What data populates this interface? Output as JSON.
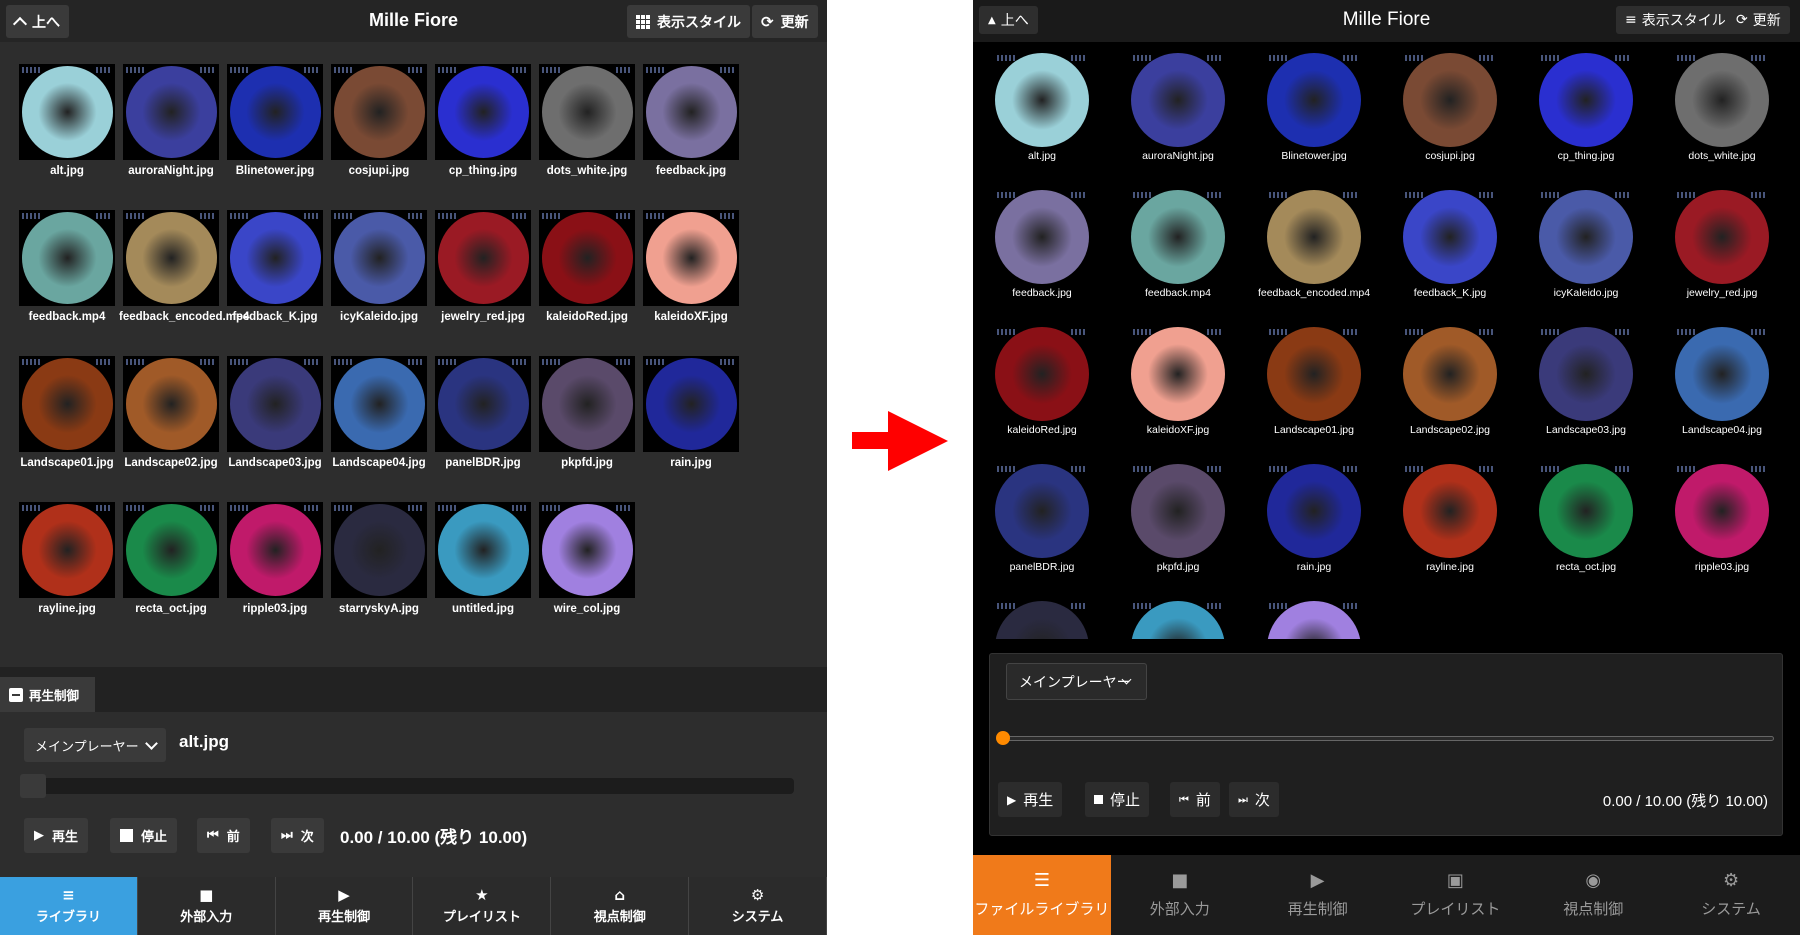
{
  "left": {
    "header": {
      "up_label": "上へ",
      "title": "Mille Fiore",
      "style_label": "表示スタイル",
      "refresh_label": "更新"
    },
    "library": [
      {
        "name": "alt.jpg",
        "color": "#9ad0d8"
      },
      {
        "name": "auroraNight.jpg",
        "color": "#3b3f9e"
      },
      {
        "name": "Blinetower.jpg",
        "color": "#1d2fb0"
      },
      {
        "name": "cosjupi.jpg",
        "color": "#7a4a34"
      },
      {
        "name": "cp_thing.jpg",
        "color": "#2a2fd0"
      },
      {
        "name": "dots_white.jpg",
        "color": "#6e6e6e"
      },
      {
        "name": "feedback.jpg",
        "color": "#7a70a0"
      },
      {
        "name": "feedback.mp4",
        "color": "#6aa6a0"
      },
      {
        "name": "feedback_encoded.mp4",
        "color": "#a48a5a"
      },
      {
        "name": "feedback_K.jpg",
        "color": "#3a46c8"
      },
      {
        "name": "icyKaleido.jpg",
        "color": "#4a5aa8"
      },
      {
        "name": "jewelry_red.jpg",
        "color": "#9a1a24"
      },
      {
        "name": "kaleidoRed.jpg",
        "color": "#8a1016"
      },
      {
        "name": "kaleidoXF.jpg",
        "color": "#f0a090"
      },
      {
        "name": "Landscape01.jpg",
        "color": "#8a3a14"
      },
      {
        "name": "Landscape02.jpg",
        "color": "#a05a28"
      },
      {
        "name": "Landscape03.jpg",
        "color": "#3a3a7a"
      },
      {
        "name": "Landscape04.jpg",
        "color": "#3a6ab0"
      },
      {
        "name": "panelBDR.jpg",
        "color": "#2a3480"
      },
      {
        "name": "pkpfd.jpg",
        "color": "#5a4a6a"
      },
      {
        "name": "rain.jpg",
        "color": "#20289a"
      },
      {
        "name": "rayline.jpg",
        "color": "#b0301a"
      },
      {
        "name": "recta_oct.jpg",
        "color": "#1a8a4a"
      },
      {
        "name": "ripple03.jpg",
        "color": "#c01a6a"
      },
      {
        "name": "starryskyA.jpg",
        "color": "#2a2a40"
      },
      {
        "name": "untitled.jpg",
        "color": "#3a9ac0"
      },
      {
        "name": "wire_col.jpg",
        "color": "#a080e0"
      }
    ],
    "section_label": "再生制御",
    "control": {
      "player_select": "メインプレーヤー",
      "current_file": "alt.jpg",
      "play_label": "再生",
      "stop_label": "停止",
      "prev_label": "前",
      "next_label": "次",
      "time": "0.00 / 10.00 (残り 10.00)"
    },
    "nav": [
      {
        "label": "ライブラリ",
        "icon": "list-icon",
        "glyph": "≡"
      },
      {
        "label": "外部入力",
        "icon": "camera-icon",
        "glyph": "■"
      },
      {
        "label": "再生制御",
        "icon": "play-icon",
        "glyph": "▶"
      },
      {
        "label": "プレイリスト",
        "icon": "star-icon",
        "glyph": "★"
      },
      {
        "label": "視点制御",
        "icon": "home-icon",
        "glyph": "⌂"
      },
      {
        "label": "システム",
        "icon": "gear-icon",
        "glyph": "⚙"
      }
    ]
  },
  "right": {
    "header": {
      "up_label": "上へ",
      "title": "Mille Fiore",
      "style_label": "表示スタイル",
      "refresh_label": "更新"
    },
    "library": [
      {
        "name": "alt.jpg",
        "color": "#9ad0d8"
      },
      {
        "name": "auroraNight.jpg",
        "color": "#3b3f9e"
      },
      {
        "name": "Blinetower.jpg",
        "color": "#1d2fb0"
      },
      {
        "name": "cosjupi.jpg",
        "color": "#7a4a34"
      },
      {
        "name": "cp_thing.jpg",
        "color": "#2a2fd0"
      },
      {
        "name": "dots_white.jpg",
        "color": "#6e6e6e"
      },
      {
        "name": "feedback.jpg",
        "color": "#7a70a0"
      },
      {
        "name": "feedback.mp4",
        "color": "#6aa6a0"
      },
      {
        "name": "feedback_encoded.mp4",
        "color": "#a48a5a"
      },
      {
        "name": "feedback_K.jpg",
        "color": "#3a46c8"
      },
      {
        "name": "icyKaleido.jpg",
        "color": "#4a5aa8"
      },
      {
        "name": "jewelry_red.jpg",
        "color": "#9a1a24"
      },
      {
        "name": "kaleidoRed.jpg",
        "color": "#8a1016"
      },
      {
        "name": "kaleidoXF.jpg",
        "color": "#f0a090"
      },
      {
        "name": "Landscape01.jpg",
        "color": "#8a3a14"
      },
      {
        "name": "Landscape02.jpg",
        "color": "#a05a28"
      },
      {
        "name": "Landscape03.jpg",
        "color": "#3a3a7a"
      },
      {
        "name": "Landscape04.jpg",
        "color": "#3a6ab0"
      },
      {
        "name": "panelBDR.jpg",
        "color": "#2a3480"
      },
      {
        "name": "pkpfd.jpg",
        "color": "#5a4a6a"
      },
      {
        "name": "rain.jpg",
        "color": "#20289a"
      },
      {
        "name": "rayline.jpg",
        "color": "#b0301a"
      },
      {
        "name": "recta_oct.jpg",
        "color": "#1a8a4a"
      },
      {
        "name": "ripple03.jpg",
        "color": "#c01a6a"
      },
      {
        "name": "",
        "color": "#2a2a40"
      },
      {
        "name": "",
        "color": "#3a9ac0"
      },
      {
        "name": "",
        "color": "#a080e0"
      }
    ],
    "control": {
      "player_select": "メインプレーヤー",
      "play_label": "再生",
      "stop_label": "停止",
      "prev_label": "前",
      "next_label": "次",
      "time": "0.00 / 10.00 (残り 10.00)"
    },
    "nav": [
      {
        "label": "ファイルライブラリ",
        "icon": "list-icon",
        "glyph": "☰"
      },
      {
        "label": "外部入力",
        "icon": "camera-icon",
        "glyph": "■"
      },
      {
        "label": "再生制御",
        "icon": "play-icon",
        "glyph": "▶"
      },
      {
        "label": "プレイリスト",
        "icon": "film-icon",
        "glyph": "▣"
      },
      {
        "label": "視点制御",
        "icon": "eye-icon",
        "glyph": "◉"
      },
      {
        "label": "システム",
        "icon": "gear-icon",
        "glyph": "⚙"
      }
    ]
  },
  "colors": {
    "left_active_tab": "#3aa0e0",
    "right_active_tab": "#f07a1a",
    "seek_dot": "#ff8a00",
    "arrow": "#ff0000"
  }
}
